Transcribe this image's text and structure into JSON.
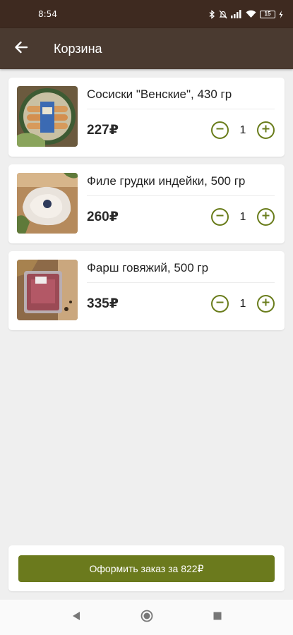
{
  "status_bar": {
    "time": "8:54",
    "battery": "15",
    "icons": [
      "bluetooth-icon",
      "bell-off-icon",
      "signal-icon",
      "wifi-icon",
      "battery-icon",
      "charging-icon"
    ]
  },
  "app_bar": {
    "title": "Корзина",
    "back_icon": "arrow-left-icon"
  },
  "cart": {
    "items": [
      {
        "name": "Сосиски \"Венские\", 430 гр",
        "price": "227₽",
        "quantity": "1"
      },
      {
        "name": "Филе грудки индейки, 500 гр",
        "price": "260₽",
        "quantity": "1"
      },
      {
        "name": "Фарш говяжий, 500 гр",
        "price": "335₽",
        "quantity": "1"
      }
    ]
  },
  "order": {
    "button_label": "Оформить заказ за 822₽"
  },
  "colors": {
    "status_bar": "#3e2a20",
    "app_bar": "#4a3a30",
    "accent": "#6b7a1d",
    "background": "#efefef"
  },
  "nav_bar": {
    "icons": [
      "back-triangle-icon",
      "home-circle-icon",
      "recents-square-icon"
    ]
  }
}
